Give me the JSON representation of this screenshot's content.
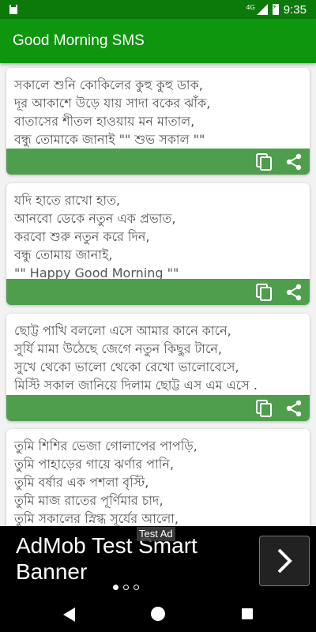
{
  "status_bar": {
    "network": "4G",
    "time": "9:35"
  },
  "app_bar": {
    "title": "Good Morning SMS"
  },
  "cards": [
    {
      "text": "সকালে শুনি কোকিলের কুহু কুহু ডাক,\nদূর আকাশে উড়ে যায় সাদা বকের ঝাঁক,\nবাতাসের শীতল হাওয়ায় মন মাতাল,\nবন্ধু তোমাকে জানাই \"\" শুভ সকাল \"\""
    },
    {
      "text": "যদি হাতে রাখো হাত,\nআনবো ডেকে নতুন এক প্রভাত,\nকরবো শুরু নতুন করে দিন,\nবন্ধু তোমায় জানাই,\n\"\" Happy Good Morning \"\""
    },
    {
      "text": "ছোট্ট পাখি বললো এসে আমার কানে কানে,\nসুর্যি মামা উঠেছে জেগে নতুন কিছুর টানে,\nসুখে থেকো ভালো থেকো রেখো ভালোবেসে,\nমিস্টি সকাল জানিয়ে দিলাম ছোট্ট এস এম এসে ."
    },
    {
      "text": "তুমি শিশির ভেজা গোলাপের পাপড়ি,\nতুমি পাহাড়ের গায়ে ঝর্ণার পানি,\nতুমি বর্ষার এক পশলা বৃস্টি,\nতুমি মাজ রাতের পূর্ণিমার চাদ,\nতুমি সকালের স্নিগ্ধ সূর্যের আলো,\nতুমি হলে আমার বন্ধু সবচেয়ে ভালো"
    }
  ],
  "ad": {
    "label": "Test Ad",
    "text": "AdMob Test Smart Banner"
  },
  "colors": {
    "status_bar": "#0b7a0b",
    "app_bar": "#0f960f",
    "card_footer": "#4e9e4e"
  },
  "icons": [
    "copy-icon",
    "share-icon",
    "chevron-right-icon",
    "back-icon",
    "home-icon",
    "recents-icon"
  ]
}
